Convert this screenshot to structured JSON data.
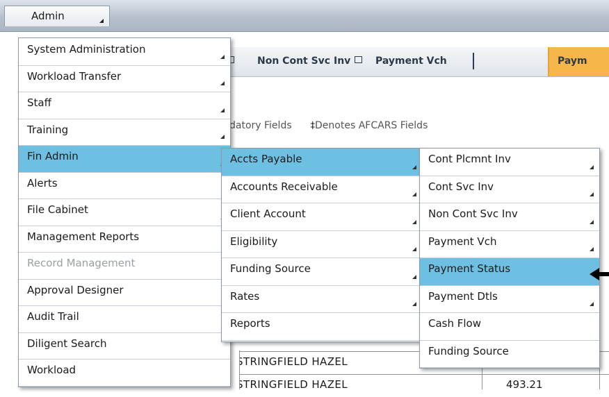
{
  "admin_button": {
    "label": "Admin"
  },
  "background": {
    "tabs": [
      "Non Cont Svc Inv",
      "Payment Vch",
      "Paym"
    ],
    "fields_text": "datory Fields",
    "afcars_mark": "‡",
    "afcars_text": "Denotes AFCARS Fields",
    "rows": [
      {
        "name": "STRINGFIELD HAZEL",
        "amount": ""
      },
      {
        "name": "STRINGFIELD HAZEL",
        "amount": "493.21"
      }
    ]
  },
  "menu_main": [
    {
      "label": "System Administration",
      "submenu": true
    },
    {
      "label": "Workload Transfer",
      "submenu": true
    },
    {
      "label": "Staff",
      "submenu": true
    },
    {
      "label": "Training",
      "submenu": true
    },
    {
      "label": "Fin Admin",
      "submenu": true,
      "active": true
    },
    {
      "label": "Alerts",
      "submenu": false
    },
    {
      "label": "File Cabinet",
      "submenu": true
    },
    {
      "label": "Management Reports",
      "submenu": false
    },
    {
      "label": "Record Management",
      "submenu": false,
      "disabled": true
    },
    {
      "label": "Approval Designer",
      "submenu": false
    },
    {
      "label": "Audit Trail",
      "submenu": false
    },
    {
      "label": "Diligent Search",
      "submenu": false
    },
    {
      "label": "Workload",
      "submenu": false
    }
  ],
  "menu_fin_admin": [
    {
      "label": "Accts Payable",
      "submenu": true,
      "active": true
    },
    {
      "label": "Accounts Receivable",
      "submenu": true
    },
    {
      "label": "Client Account",
      "submenu": true
    },
    {
      "label": "Eligibility",
      "submenu": true
    },
    {
      "label": "Funding Source",
      "submenu": true
    },
    {
      "label": "Rates",
      "submenu": true
    },
    {
      "label": "Reports",
      "submenu": false
    }
  ],
  "menu_accts_payable": [
    {
      "label": "Cont Plcmnt Inv",
      "submenu": true
    },
    {
      "label": "Cont Svc Inv",
      "submenu": true
    },
    {
      "label": "Non Cont Svc Inv",
      "submenu": true
    },
    {
      "label": "Payment Vch",
      "submenu": true
    },
    {
      "label": "Payment Status",
      "submenu": false,
      "active": true
    },
    {
      "label": "Payment Dtls",
      "submenu": true
    },
    {
      "label": "Cash Flow",
      "submenu": false
    },
    {
      "label": "Funding Source",
      "submenu": false
    }
  ],
  "colors": {
    "active": "#6ec0e3",
    "tab_highlight": "#f6b64c"
  }
}
